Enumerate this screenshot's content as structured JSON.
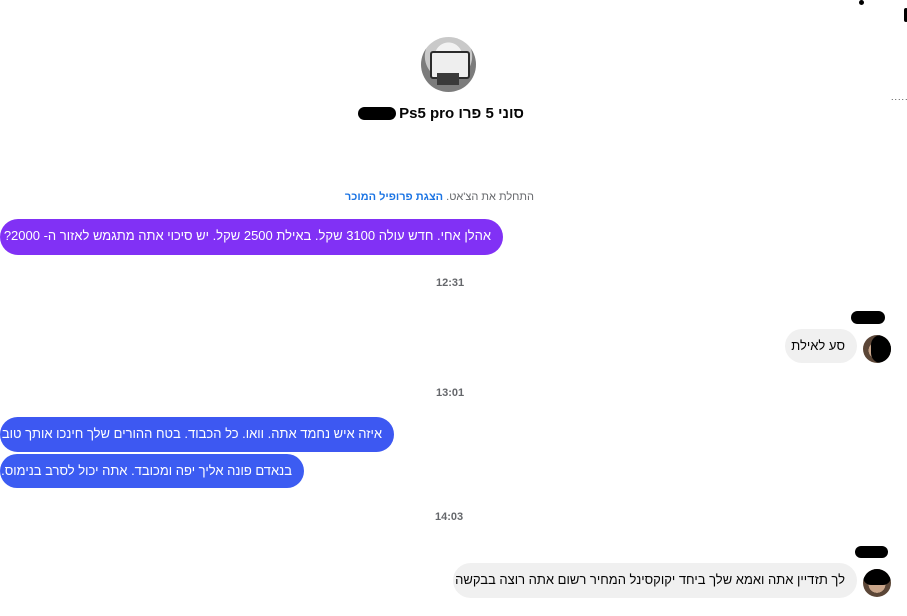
{
  "header": {
    "title": "סוני 5 פרו Ps5 pro ·",
    "menu_dots": "......"
  },
  "system_notice": {
    "text": "התחלת את הצ'אט.",
    "link": "הצגת פרופיל המוכר"
  },
  "messages": [
    {
      "id": "m1",
      "direction": "outgoing",
      "text": "אהלן אחי. חדש עולה 3100 שקל. באילת 2500 שקל. יש סיכוי אתה מתגמש לאזור ה- 2000?",
      "color": "#8131f5"
    },
    {
      "id": "t1",
      "timestamp": "12:31"
    },
    {
      "id": "m2",
      "direction": "incoming",
      "text": "סע לאילת"
    },
    {
      "id": "t2",
      "timestamp": "13:01"
    },
    {
      "id": "m3",
      "direction": "outgoing",
      "text": "איזה איש נחמד אתה. וואו. כל הכבוד. בטח ההורים שלך חינכו אותך טוב",
      "color": "#3d58f2"
    },
    {
      "id": "m4",
      "direction": "outgoing",
      "text": "בנאדם פונה אליך יפה ומכובד. אתה יכול לסרב בנימוס.",
      "color": "#3c5cf2"
    },
    {
      "id": "t3",
      "timestamp": "14:03"
    },
    {
      "id": "m5",
      "direction": "incoming",
      "text": "לך תזדיין אתה ואמא שלך ביחד יקוקסינל המחיר רשום אתה רוצה בבקשה"
    }
  ],
  "colors": {
    "outgoing_purple": "#8131f5",
    "outgoing_blue": "#3d58f2",
    "incoming_bg": "#f0f0f0",
    "link": "#1b74e4"
  }
}
